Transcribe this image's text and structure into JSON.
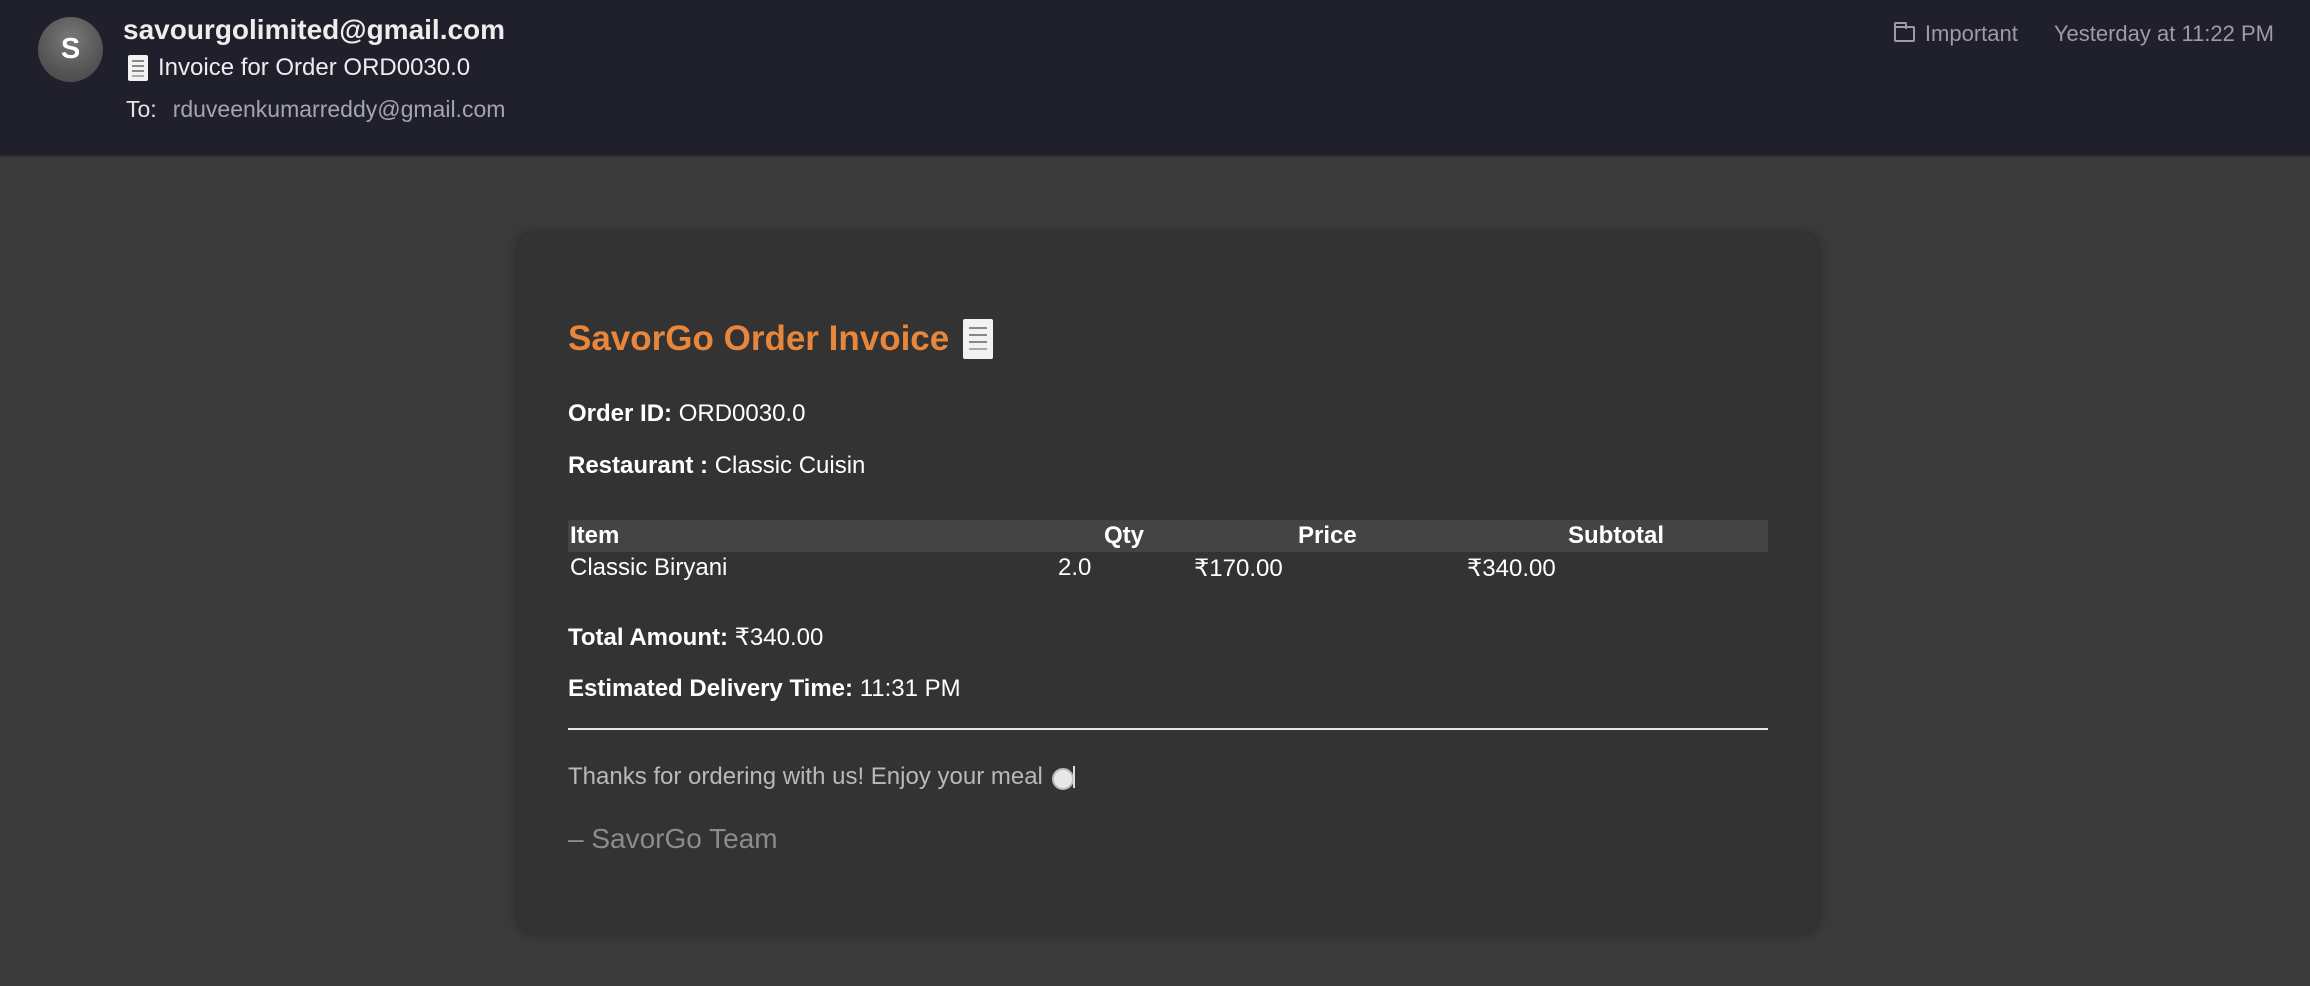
{
  "header": {
    "avatar_letter": "S",
    "sender": "savourgolimited@gmail.com",
    "subject": "Invoice for Order ORD0030.0",
    "to_label": "To:",
    "to_address": "rduveenkumarreddy@gmail.com",
    "folder": "Important",
    "date": "Yesterday at 11:22 PM"
  },
  "invoice": {
    "title": "SavorGo Order Invoice",
    "order_id_label": "Order ID:",
    "order_id": "ORD0030.0",
    "restaurant_label": "Restaurant :",
    "restaurant": "Classic Cuisin",
    "table": {
      "headers": [
        "Item",
        "Qty",
        "Price",
        "Subtotal"
      ],
      "rows": [
        [
          "Classic Biryani",
          "2.0",
          "₹170.00",
          "₹340.00"
        ]
      ]
    },
    "total_label": "Total Amount:",
    "total": "₹340.00",
    "eta_label": "Estimated Delivery Time:",
    "eta": "11:31 PM",
    "thanks": "Thanks for ordering with us! Enjoy your meal",
    "signoff": "– SavorGo Team"
  },
  "colors": {
    "accent": "#e8863b",
    "header_bg": "#201f2c",
    "page_bg": "#3a3a3a",
    "card_bg": "#333333"
  }
}
